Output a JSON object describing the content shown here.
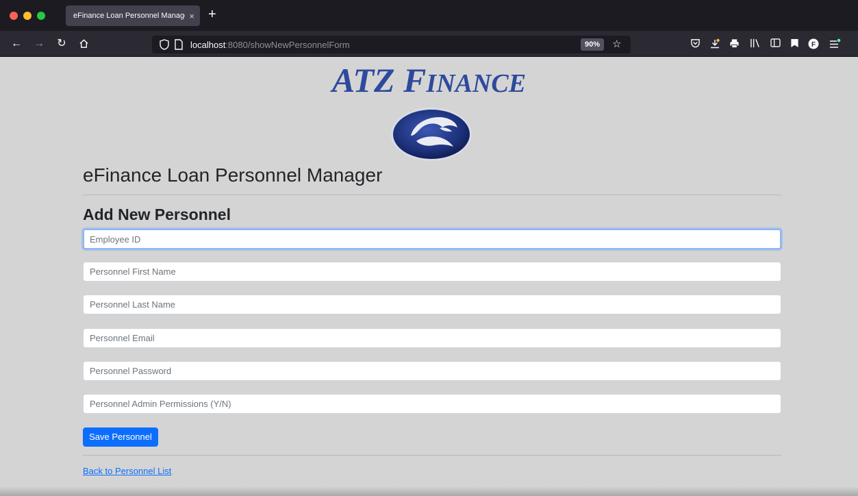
{
  "browser": {
    "tab_title": "eFinance Loan Personnel Manager",
    "tab_close": "×",
    "new_tab": "+",
    "url_host": "localhost",
    "url_path": ":8080/showNewPersonnelForm",
    "zoom": "90%",
    "account_initial": "F"
  },
  "logo": {
    "wordmark_a": "A",
    "wordmark_tz": "TZ ",
    "wordmark_f": "F",
    "wordmark_inance": "INANCE"
  },
  "page": {
    "title": "eFinance Loan Personnel Manager",
    "form_title": "Add New Personnel"
  },
  "form": {
    "employee_id_placeholder": "Employee ID",
    "first_name_placeholder": "Personnel First Name",
    "last_name_placeholder": "Personnel Last Name",
    "email_placeholder": "Personnel Email",
    "password_placeholder": "Personnel Password",
    "admin_placeholder": "Personnel Admin Permissions (Y/N)",
    "save_label": "Save Personnel"
  },
  "footer": {
    "back_link": "Back to Personnel List"
  },
  "colors": {
    "page_bg": "#d4d4d4",
    "brand_blue": "#2d4a9c",
    "button_blue": "#0d6efd"
  }
}
